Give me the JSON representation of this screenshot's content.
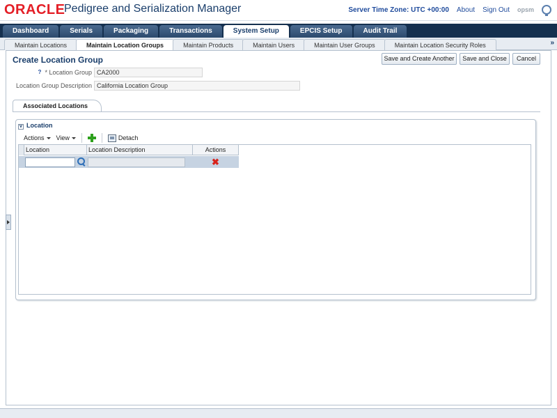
{
  "header": {
    "logo": "ORACLE",
    "app_title": "Pedigree and Serialization Manager",
    "server_time_zone": "Server Time Zone: UTC +00:00",
    "about": "About",
    "sign_out": "Sign Out",
    "brand_tag": "opsm"
  },
  "main_tabs": [
    {
      "label": "Dashboard",
      "active": false
    },
    {
      "label": "Serials",
      "active": false
    },
    {
      "label": "Packaging",
      "active": false
    },
    {
      "label": "Transactions",
      "active": false
    },
    {
      "label": "System Setup",
      "active": true
    },
    {
      "label": "EPCIS Setup",
      "active": false
    },
    {
      "label": "Audit Trail",
      "active": false
    }
  ],
  "sub_tabs": [
    {
      "label": "Maintain Locations",
      "active": false
    },
    {
      "label": "Maintain Location Groups",
      "active": true
    },
    {
      "label": "Maintain Products",
      "active": false
    },
    {
      "label": "Maintain Users",
      "active": false
    },
    {
      "label": "Maintain User Groups",
      "active": false
    },
    {
      "label": "Maintain Location Security Roles",
      "active": false
    }
  ],
  "sub_tabs_more": "»",
  "page": {
    "title": "Create Location Group",
    "buttons": {
      "save_create_another": "Save and Create Another",
      "save_close": "Save and Close",
      "cancel": "Cancel"
    },
    "help_mark": "?",
    "fields": {
      "location_group_label": "* Location Group",
      "location_group_value": "CA2000",
      "description_label": "Location Group Description",
      "description_value": "California Location Group"
    }
  },
  "associated": {
    "tab_label": "Associated Locations",
    "panel_title": "Location",
    "toolbar": {
      "actions": "Actions",
      "view": "View",
      "detach": "Detach"
    },
    "table": {
      "columns": [
        "Location",
        "Location Description",
        "Actions"
      ],
      "rows": [
        {
          "location": "",
          "description": ""
        }
      ]
    }
  }
}
